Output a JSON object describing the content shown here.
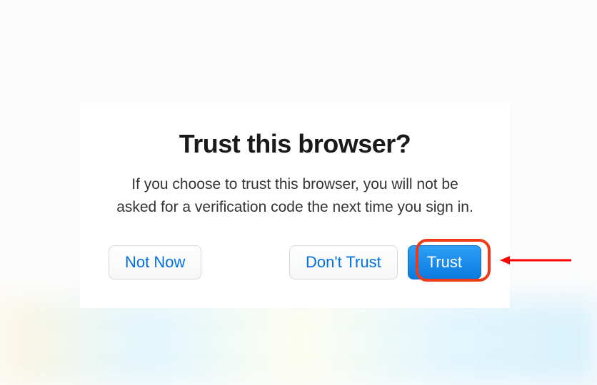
{
  "dialog": {
    "title": "Trust this browser?",
    "message": "If you choose to trust this browser, you will not be asked for a verification code the next time you sign in.",
    "not_now_label": "Not Now",
    "dont_trust_label": "Don't Trust",
    "trust_label": "Trust"
  },
  "annotation": {
    "highlighted_button": "trust",
    "colors": {
      "highlight_ring": "#f03a17",
      "arrow": "#ff0000",
      "primary_button_bg": "#0a7ae0",
      "secondary_button_text": "#0071e3"
    }
  }
}
